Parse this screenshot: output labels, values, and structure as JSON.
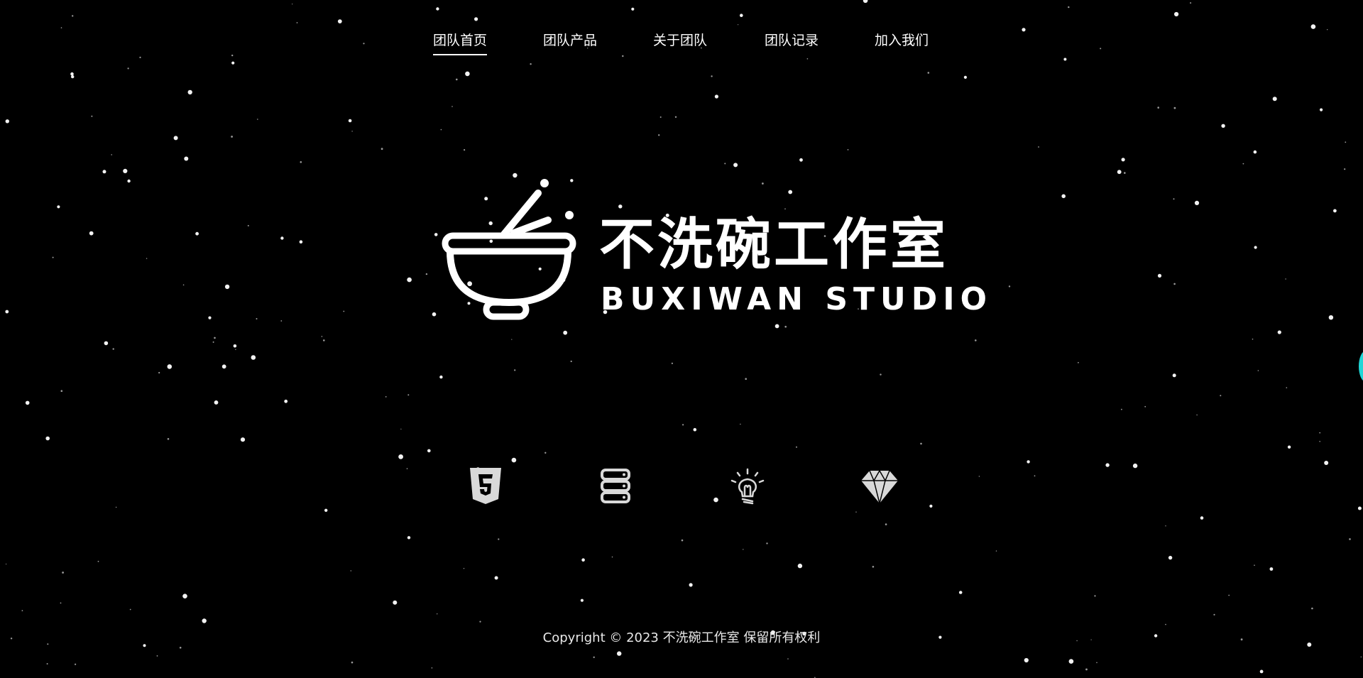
{
  "nav": {
    "items": [
      {
        "label": "团队首页",
        "active": true
      },
      {
        "label": "团队产品",
        "active": false
      },
      {
        "label": "关于团队",
        "active": false
      },
      {
        "label": "团队记录",
        "active": false
      },
      {
        "label": "加入我们",
        "active": false
      }
    ]
  },
  "brand": {
    "name_cn": "不洗碗工作室",
    "name_en": "BUXIWAN STUDIO",
    "logo_icon": "bowl-chopsticks-icon"
  },
  "tech_icons": [
    "html5-icon",
    "database-icon",
    "lightbulb-icon",
    "diamond-icon"
  ],
  "footer": {
    "copyright": "Copyright © 2023 不洗碗工作室 保留所有权利"
  },
  "colors": {
    "background": "#000000",
    "foreground": "#ffffff",
    "icon": "#d9d9d9",
    "edge_accent": "#20d6d6"
  }
}
